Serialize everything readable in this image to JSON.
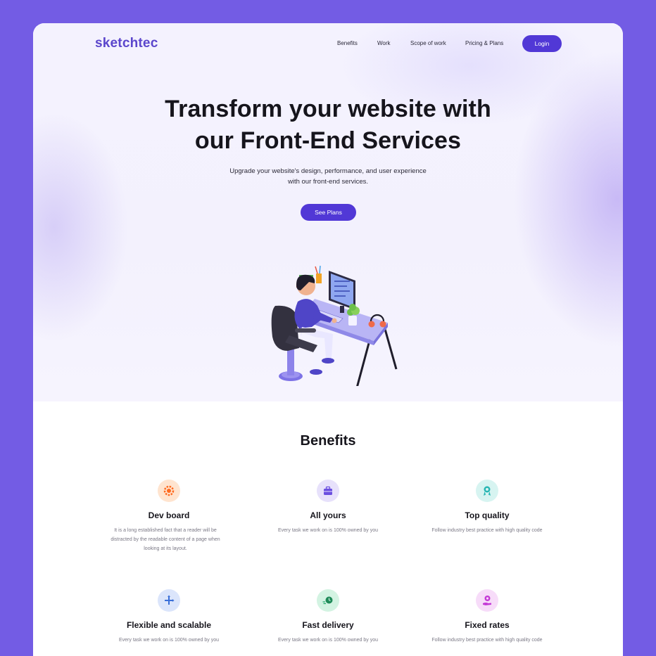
{
  "brand": {
    "logo_text": "sketchtec"
  },
  "nav": {
    "items": [
      {
        "label": "Benefits"
      },
      {
        "label": "Work"
      },
      {
        "label": "Scope of work"
      },
      {
        "label": "Pricing & Plans"
      }
    ],
    "login_label": "Login"
  },
  "hero": {
    "title_line1": "Transform your website with",
    "title_line2": "our Front-End Services",
    "subtitle_line1": "Upgrade your website's design, performance, and user experience",
    "subtitle_line2": "with our front-end services.",
    "cta_label": "See Plans"
  },
  "benefits": {
    "heading": "Benefits",
    "items": [
      {
        "icon": "gear-icon",
        "title": "Dev board",
        "desc": "It is a long established fact that a reader will be distracted by the readable content of a page when looking at its layout.",
        "color": "#ff7a2f"
      },
      {
        "icon": "briefcase-icon",
        "title": "All yours",
        "desc": "Every task we work on is 100% owned by you",
        "color": "#6b4fe0"
      },
      {
        "icon": "award-badge-icon",
        "title": "Top quality",
        "desc": "Follow industry best practice with high quality code",
        "color": "#27b6b3"
      },
      {
        "icon": "expand-arrows-icon",
        "title": "Flexible and scalable",
        "desc": "Every task we work on is 100% owned by you",
        "color": "#3a6fd8"
      },
      {
        "icon": "fast-clock-icon",
        "title": "Fast delivery",
        "desc": "Every task we work on is 100% owned by you",
        "color": "#1fa86a"
      },
      {
        "icon": "hand-coin-icon",
        "title": "Fixed rates",
        "desc": "Follow industry best practice with high quality code",
        "color": "#c43ad6"
      }
    ]
  }
}
